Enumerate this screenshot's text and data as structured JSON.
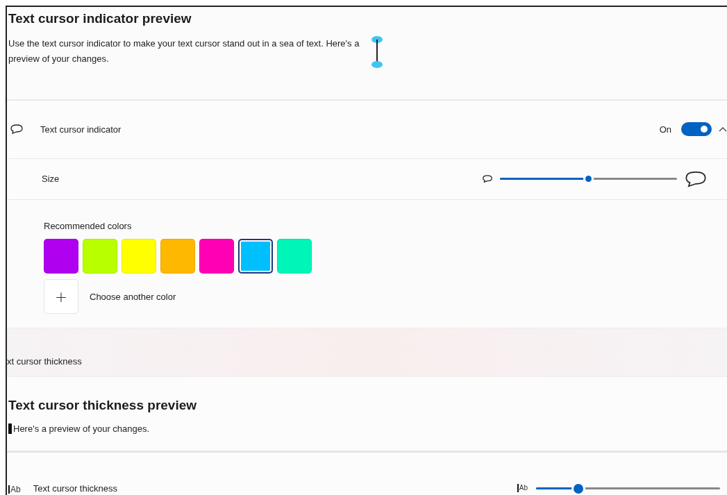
{
  "indicator_preview": {
    "title": "Text cursor indicator preview",
    "description": "Use the text cursor indicator to make your text cursor stand out in a sea of text. Here's a preview of your changes."
  },
  "indicator_toggle": {
    "label": "Text cursor indicator",
    "state_label": "On",
    "on": true,
    "expanded": true
  },
  "size": {
    "label": "Size",
    "level": 0.5
  },
  "colors": {
    "label": "Recommended colors",
    "swatches": [
      {
        "color": "#b000f0",
        "selected": false
      },
      {
        "color": "#b8ff00",
        "selected": false
      },
      {
        "color": "#ffff00",
        "selected": false
      },
      {
        "color": "#ffb800",
        "selected": false
      },
      {
        "color": "#ff00b4",
        "selected": false
      },
      {
        "color": "#00bfff",
        "selected": true
      },
      {
        "color": "#00f5b8",
        "selected": false
      }
    ],
    "add_symbol": "+",
    "choose_label": "Choose another color"
  },
  "section_header": "xt cursor thickness",
  "thickness_preview": {
    "title": "Text cursor thickness preview",
    "description": "Here's a preview of your changes."
  },
  "thickness": {
    "label": "Text cursor thickness",
    "icon_text": "Ab",
    "slider_icon_text": "Ab",
    "level": 0.23
  }
}
